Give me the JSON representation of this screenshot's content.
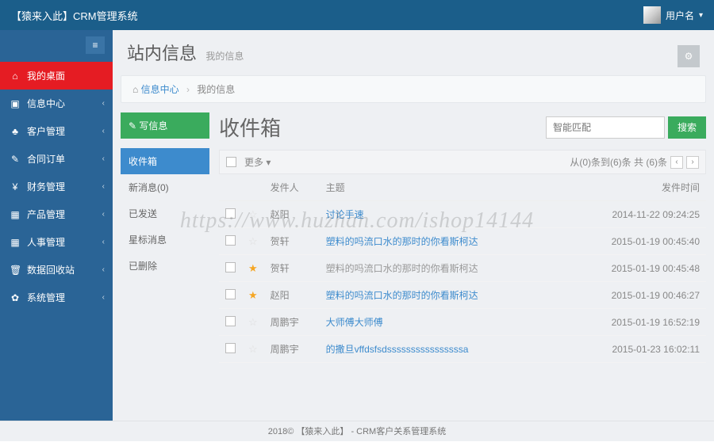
{
  "topbar": {
    "brand": "【猿来入此】CRM管理系统",
    "username": "用户名"
  },
  "sidebar": {
    "items": [
      {
        "icon": "⌂",
        "label": "我的桌面",
        "active": true,
        "has_sub": false
      },
      {
        "icon": "▣",
        "label": "信息中心",
        "active": false,
        "has_sub": true
      },
      {
        "icon": "♣",
        "label": "客户管理",
        "active": false,
        "has_sub": true
      },
      {
        "icon": "✎",
        "label": "合同订单",
        "active": false,
        "has_sub": true
      },
      {
        "icon": "¥",
        "label": "财务管理",
        "active": false,
        "has_sub": true
      },
      {
        "icon": "▦",
        "label": "产品管理",
        "active": false,
        "has_sub": true
      },
      {
        "icon": "▦",
        "label": "人事管理",
        "active": false,
        "has_sub": true
      },
      {
        "icon": "🗑",
        "label": "数据回收站",
        "active": false,
        "has_sub": true
      },
      {
        "icon": "✿",
        "label": "系统管理",
        "active": false,
        "has_sub": true
      }
    ]
  },
  "page": {
    "title": "站内信息",
    "subtitle": "我的信息"
  },
  "breadcrumb": {
    "home_icon": "⌂",
    "parent": "信息中心",
    "current": "我的信息"
  },
  "compose": {
    "label": "✎ 写信息"
  },
  "folders": [
    {
      "label": "收件箱",
      "active": true
    },
    {
      "label": "新消息(0)",
      "active": false
    },
    {
      "label": "已发送",
      "active": false
    },
    {
      "label": "星标消息",
      "active": false
    },
    {
      "label": "已删除",
      "active": false
    }
  ],
  "inbox": {
    "title": "收件箱",
    "search_placeholder": "智能匹配",
    "search_btn": "搜索",
    "more_label": "更多 ▾",
    "pager_text": "从(0)条到(6)条 共 (6)条",
    "columns": {
      "sender": "发件人",
      "subject": "主题",
      "time": "发件时间"
    },
    "rows": [
      {
        "star": false,
        "sender": "赵阳",
        "subject": "讨论手速",
        "visited": false,
        "time": "2014-11-22 09:24:25"
      },
      {
        "star": false,
        "sender": "贺轩",
        "subject": "塑料的吗流口水的那时的你看斯柯达",
        "visited": false,
        "time": "2015-01-19 00:45:40"
      },
      {
        "star": true,
        "sender": "贺轩",
        "subject": "塑料的吗流口水的那时的你看斯柯达",
        "visited": true,
        "time": "2015-01-19 00:45:48"
      },
      {
        "star": true,
        "sender": "赵阳",
        "subject": "塑料的吗流口水的那时的你看斯柯达",
        "visited": false,
        "time": "2015-01-19 00:46:27"
      },
      {
        "star": false,
        "sender": "周鹏宇",
        "subject": "大师傅大师傅",
        "visited": false,
        "time": "2015-01-19 16:52:19"
      },
      {
        "star": false,
        "sender": "周鹏宇",
        "subject": "的撒旦vffdsfsdssssssssssssssssa",
        "visited": false,
        "time": "2015-01-23 16:02:11"
      }
    ]
  },
  "footer": {
    "text": "2018© 【猿来入此】 - CRM客户关系管理系统"
  },
  "watermark": "https://www.huzhan.com/ishop14144"
}
